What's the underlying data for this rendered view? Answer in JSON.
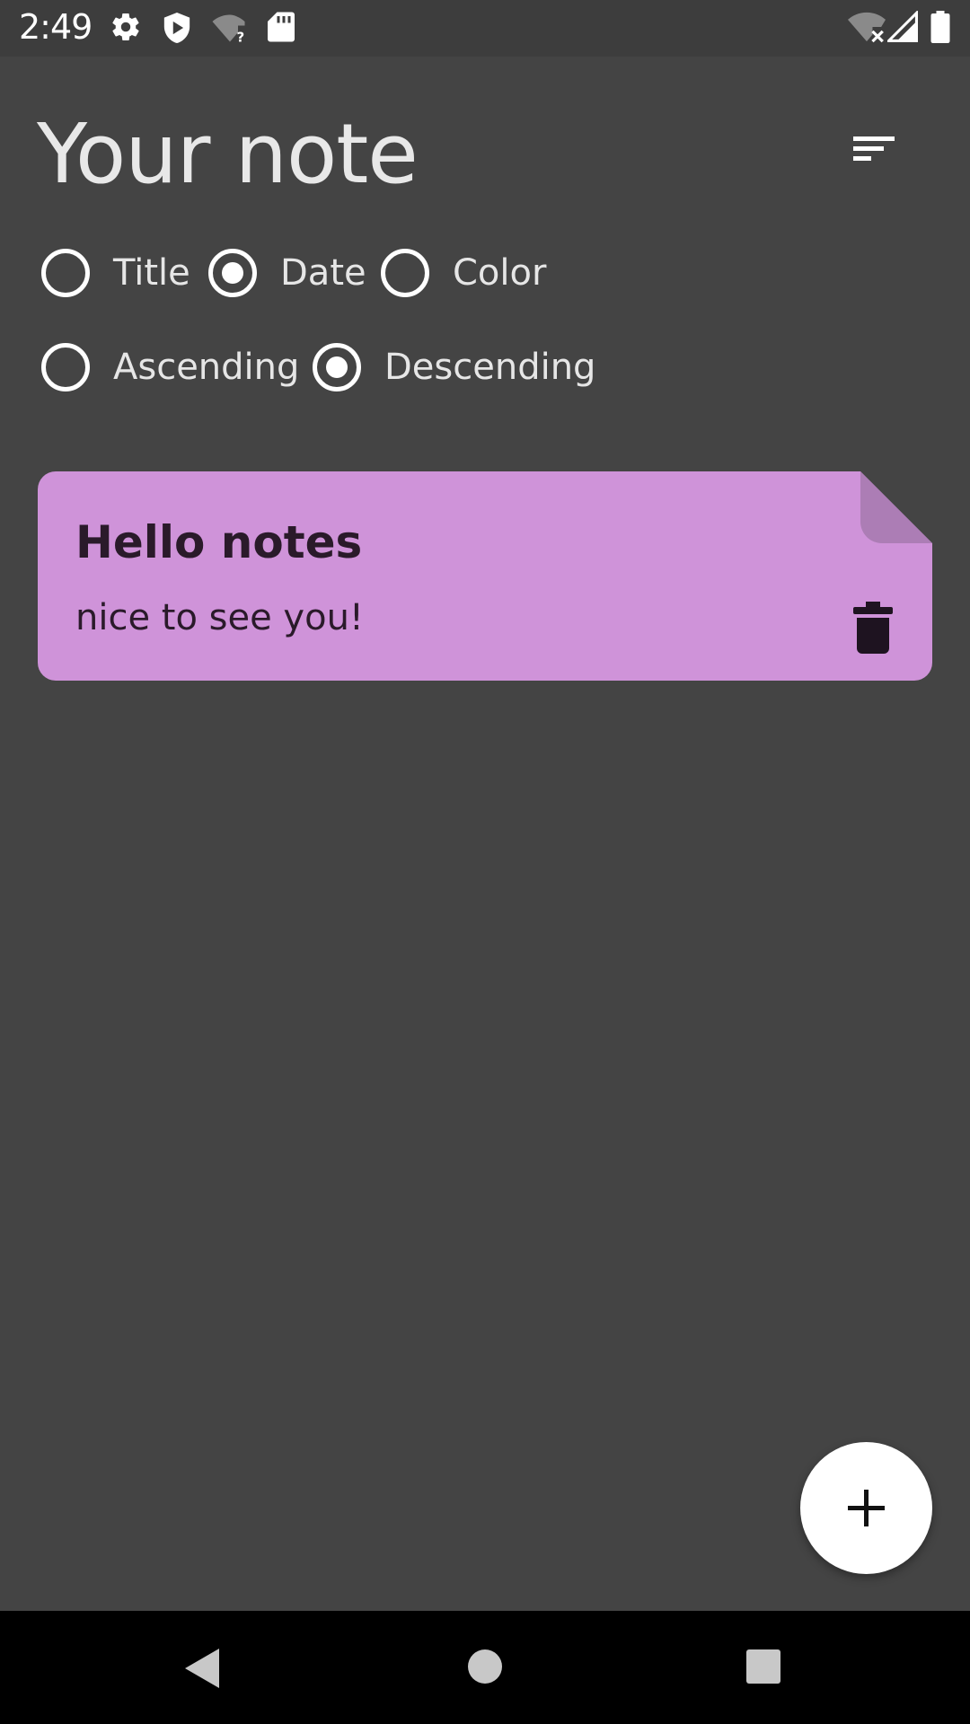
{
  "status_bar": {
    "time": "2:49",
    "left_icons": [
      "settings-icon",
      "shield-icon",
      "wifi-question-icon",
      "sd-card-icon"
    ],
    "right_icons": [
      "wifi-off-icon",
      "signal-icon",
      "battery-icon"
    ]
  },
  "header": {
    "title": "Your note",
    "sort_icon": "sort-icon"
  },
  "sort_by": {
    "options": [
      {
        "label": "Title",
        "selected": false
      },
      {
        "label": "Date",
        "selected": true
      },
      {
        "label": "Color",
        "selected": false
      }
    ]
  },
  "order": {
    "options": [
      {
        "label": "Ascending",
        "selected": false
      },
      {
        "label": "Descending",
        "selected": true
      }
    ]
  },
  "notes": [
    {
      "title": "Hello notes",
      "content": "nice to see you!",
      "color": "#CF93D9",
      "delete_icon": "trash-icon"
    }
  ],
  "fab": {
    "icon": "plus-icon"
  },
  "nav_bar": {
    "icons": [
      "back-icon",
      "home-icon",
      "recents-icon"
    ]
  },
  "colors": {
    "background": "#444444",
    "status_bar": "#3D3D3D",
    "note_card": "#CF93D9",
    "note_fold": "#AC7DB5",
    "fab": "#FFFFFF",
    "nav_bar": "#000000"
  }
}
